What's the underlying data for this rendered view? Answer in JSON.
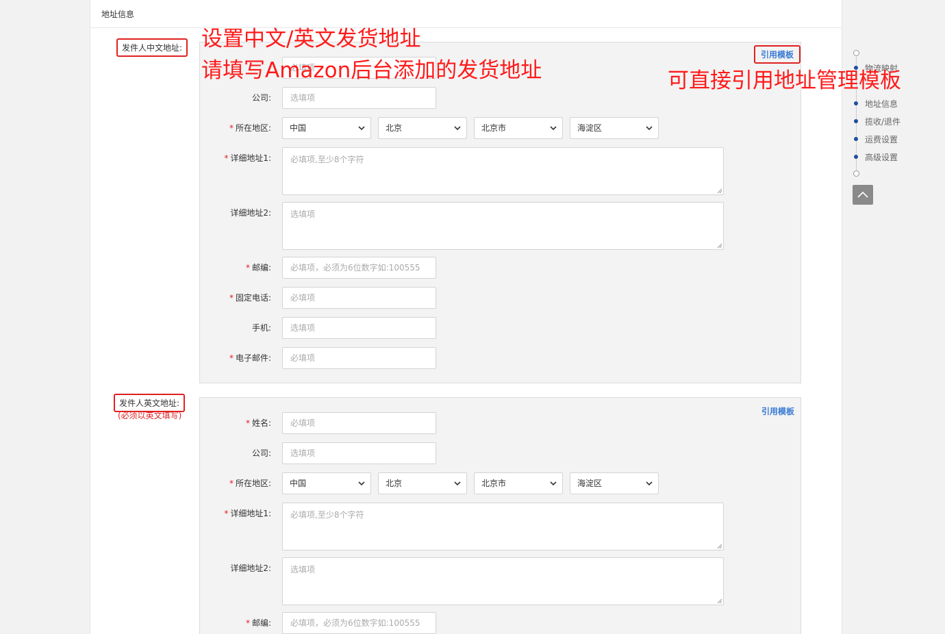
{
  "card": {
    "title": "地址信息"
  },
  "cn_section": {
    "label": "发件人中文地址:",
    "quote": "引用模板",
    "fields": {
      "name_ph": "必填项",
      "company_label": "公司:",
      "company_ph": "选填项",
      "region_label": "所在地区:",
      "addr1_label": "详细地址1:",
      "addr1_ph": "必填项,至少8个字符",
      "addr2_label": "详细地址2:",
      "addr2_ph": "选填项",
      "zip_label": "邮编:",
      "zip_ph": "必填项，必须为6位数字如:100555",
      "phone_label": "固定电话:",
      "phone_ph": "必填项",
      "mobile_label": "手机:",
      "mobile_ph": "选填项",
      "email_label": "电子邮件:",
      "email_ph": "必填项"
    },
    "region": {
      "country": "中国",
      "province": "北京",
      "city": "北京市",
      "district": "海淀区"
    }
  },
  "en_section": {
    "label": "发件人英文地址:",
    "note": "(必须以英文填写)",
    "quote": "引用模板",
    "fields": {
      "name_label": "姓名:",
      "name_ph": "必填项",
      "company_label": "公司:",
      "company_ph": "选填项",
      "region_label": "所在地区:",
      "addr1_label": "详细地址1:",
      "addr1_ph": "必填项,至少8个字符",
      "addr2_label": "详细地址2:",
      "addr2_ph": "选填项",
      "zip_label": "邮编:",
      "zip_ph": "必填项，必须为6位数字如:100555"
    },
    "region": {
      "country": "中国",
      "province": "北京",
      "city": "北京市",
      "district": "海淀区"
    }
  },
  "annotations": {
    "line1": "设置中文/英文发货地址",
    "line2": "请填写Amazon后台添加的发货地址",
    "line3": "可直接引用地址管理模板"
  },
  "nav": {
    "items": [
      "物流映射",
      "地址信息",
      "揽收/退件",
      "运费设置",
      "高级设置"
    ]
  },
  "required_mark": "*"
}
